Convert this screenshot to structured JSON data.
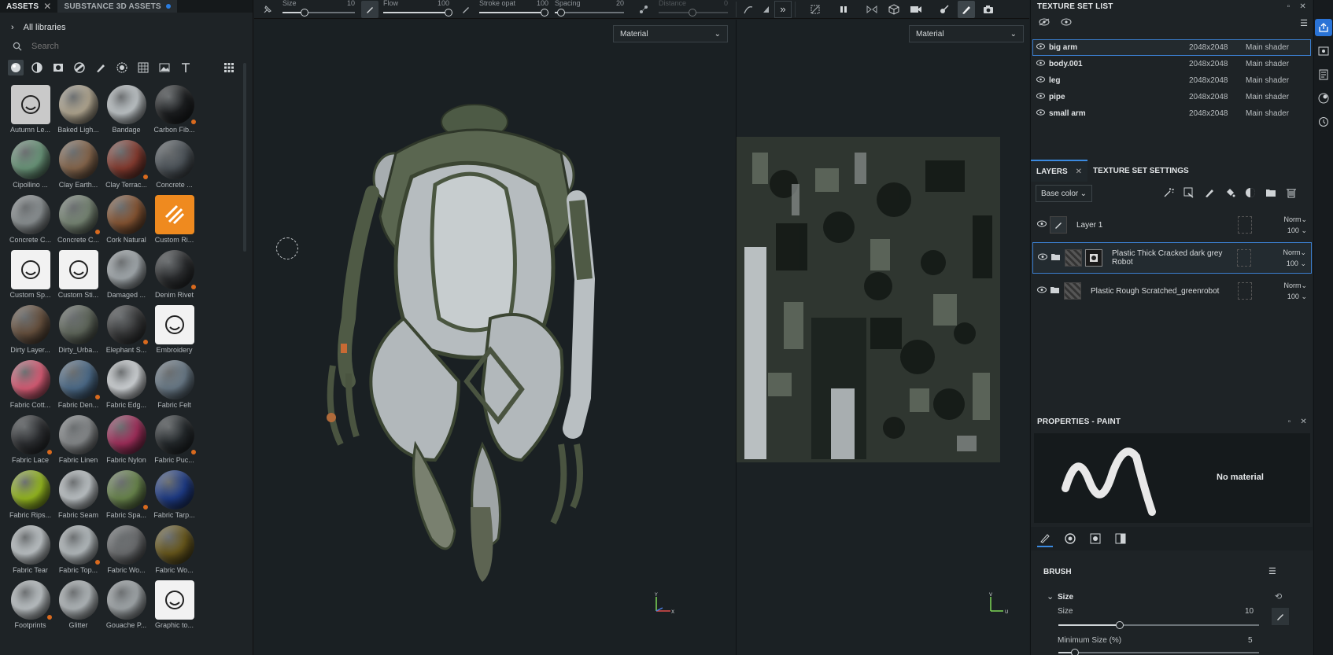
{
  "assets_panel": {
    "tabs": [
      {
        "label": "ASSETS"
      },
      {
        "label": "SUBSTANCE 3D ASSETS"
      }
    ],
    "library": "All libraries",
    "search_placeholder": "Search",
    "items": [
      {
        "label": "Autumn Le...",
        "color": "#c9c9c9",
        "icon": "leaf-icon"
      },
      {
        "label": "Baked Ligh...",
        "color": "#b8ad96"
      },
      {
        "label": "Bandage",
        "color": "#c7cdd0"
      },
      {
        "label": "Carbon Fib...",
        "color": "#1d1f21"
      },
      {
        "label": "Cipollino ...",
        "color": "#6e9b7e"
      },
      {
        "label": "Clay Earth...",
        "color": "#8b6a4f"
      },
      {
        "label": "Clay Terrac...",
        "color": "#8a3d31"
      },
      {
        "label": "Concrete ...",
        "color": "#4f565c"
      },
      {
        "label": "Concrete C...",
        "color": "#8f9597"
      },
      {
        "label": "Concrete C...",
        "color": "#7b8a78"
      },
      {
        "label": "Cork Natural",
        "color": "#8a5734"
      },
      {
        "label": "Custom Ri...",
        "color": "#ef8a1f",
        "icon": "custom-rig-icon"
      },
      {
        "label": "Custom Sp...",
        "color": "#f2f2f2",
        "icon": "spray-icon"
      },
      {
        "label": "Custom Sti...",
        "color": "#f2f2f2",
        "icon": "sticker-icon"
      },
      {
        "label": "Damaged ...",
        "color": "#a9b0b4"
      },
      {
        "label": "Denim Rivet",
        "color": "#2c2e30"
      },
      {
        "label": "Dirty Layer...",
        "color": "#6a5340"
      },
      {
        "label": "Dirty_Urba...",
        "color": "#626a5e"
      },
      {
        "label": "Elephant S...",
        "color": "#3a3b3c"
      },
      {
        "label": "Embroidery",
        "color": "#f2f2f2",
        "icon": "embroidery-icon"
      },
      {
        "label": "Fabric Cott...",
        "color": "#e0607a"
      },
      {
        "label": "Fabric Den...",
        "color": "#4f6f8e"
      },
      {
        "label": "Fabric Edg...",
        "color": "#d9dde0"
      },
      {
        "label": "Fabric Felt",
        "color": "#6d7e8c"
      },
      {
        "label": "Fabric Lace",
        "color": "#2e3033"
      },
      {
        "label": "Fabric Linen",
        "color": "#8a8d8f"
      },
      {
        "label": "Fabric Nylon",
        "color": "#a6305e"
      },
      {
        "label": "Fabric Puc...",
        "color": "#252a2d"
      },
      {
        "label": "Fabric Rips...",
        "color": "#9bbf21"
      },
      {
        "label": "Fabric Seam",
        "color": "#c5cbce"
      },
      {
        "label": "Fabric Spa...",
        "color": "#6d8a4f"
      },
      {
        "label": "Fabric Tarp...",
        "color": "#1f3d8a"
      },
      {
        "label": "Fabric Tear",
        "color": "#c5cbce"
      },
      {
        "label": "Fabric Top...",
        "color": "#bcc3c6"
      },
      {
        "label": "Fabric Wo...",
        "color": "#6e7072"
      },
      {
        "label": "Fabric Wo...",
        "color": "#6b5a1c"
      },
      {
        "label": "Footprints",
        "color": "#c5cbce"
      },
      {
        "label": "Glitter",
        "color": "#b9bfc2"
      },
      {
        "label": "Gouache P...",
        "color": "#a8aeb1"
      },
      {
        "label": "Graphic to...",
        "color": "#f2f2f2",
        "icon": "graphic-tool-icon"
      }
    ]
  },
  "toolbar": {
    "size_label": "Size",
    "size_value": "10",
    "flow_label": "Flow",
    "flow_value": "100",
    "stroke_label": "Stroke opat",
    "stroke_value": "100",
    "spacing_label": "Spacing",
    "spacing_value": "20",
    "distance_label": "Distance",
    "distance_value": "0"
  },
  "viewport": {
    "left_mode": "Material",
    "right_mode": "Material"
  },
  "texture_set_list": {
    "title": "TEXTURE SET LIST",
    "rows": [
      {
        "name": "big arm",
        "res": "2048x2048",
        "shader": "Main shader"
      },
      {
        "name": "body.001",
        "res": "2048x2048",
        "shader": "Main shader"
      },
      {
        "name": "leg",
        "res": "2048x2048",
        "shader": "Main shader"
      },
      {
        "name": "pipe",
        "res": "2048x2048",
        "shader": "Main shader"
      },
      {
        "name": "small arm",
        "res": "2048x2048",
        "shader": "Main shader"
      }
    ]
  },
  "layers": {
    "tab_layers": "LAYERS",
    "tab_settings": "TEXTURE SET SETTINGS",
    "channel": "Base color",
    "items": [
      {
        "name": "Layer 1",
        "blend": "Norm",
        "opacity": "100"
      },
      {
        "name": "Plastic Thick Cracked dark grey Robot",
        "blend": "Norm",
        "opacity": "100"
      },
      {
        "name": "Plastic Rough Scratched_greenrobot",
        "blend": "Norm",
        "opacity": "100"
      }
    ]
  },
  "properties": {
    "title": "PROPERTIES - PAINT",
    "material": "No material",
    "brush_title": "BRUSH",
    "size_group": "Size",
    "size_label": "Size",
    "size_value": "10",
    "min_size_label": "Minimum Size (%)",
    "min_size_value": "5"
  }
}
